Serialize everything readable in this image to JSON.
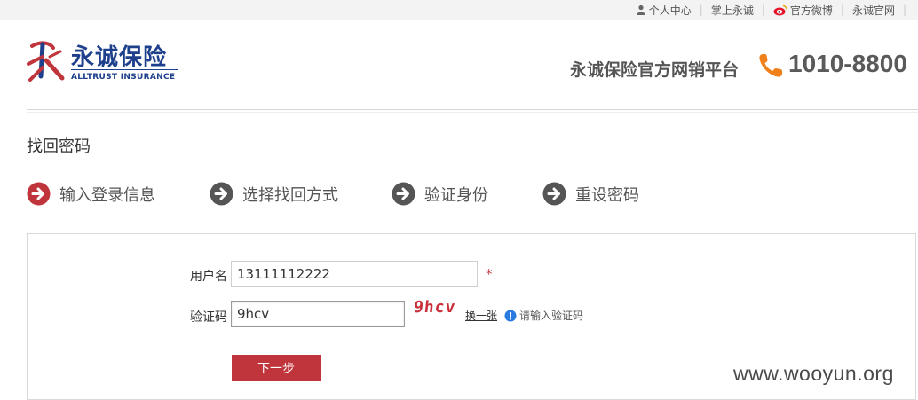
{
  "topbar": {
    "personal_center": "个人中心",
    "mobile": "掌上永诚",
    "weibo": "官方微博",
    "official_site": "永诚官网"
  },
  "header": {
    "logo_cn": "永诚保险",
    "logo_en": "ALLTRUST INSURANCE",
    "platform": "永诚保险官方网销平台",
    "hotline": "1010-8800",
    "accent_color": "#c0343b",
    "brand_color": "#1e3f8c",
    "phone_icon_color": "#f08019"
  },
  "page": {
    "title": "找回密码"
  },
  "steps": [
    {
      "label": "输入登录信息",
      "active": true
    },
    {
      "label": "选择找回方式",
      "active": false
    },
    {
      "label": "验证身份",
      "active": false
    },
    {
      "label": "重设密码",
      "active": false
    }
  ],
  "form": {
    "username_label": "用户名",
    "username_value": "13111112222",
    "required_mark": "*",
    "captcha_label": "验证码",
    "captcha_value": "9hcv",
    "captcha_image_text": "9hcv",
    "refresh_label": "换一张",
    "hint": "请输入验证码",
    "next_label": "下一步"
  },
  "watermark": "www.wooyun.org"
}
